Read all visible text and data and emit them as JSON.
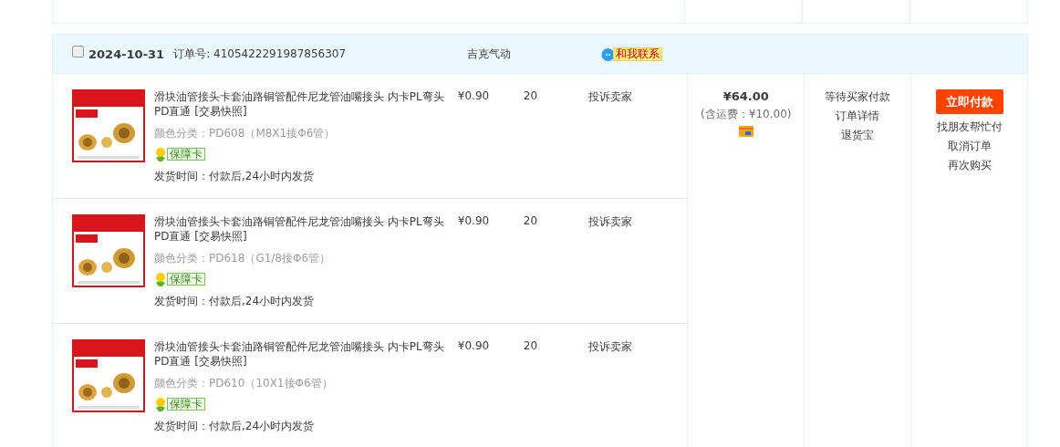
{
  "order": {
    "selected": false,
    "date": "2024-10-31",
    "order_no_label": "订单号:",
    "order_no": "4105422291987856307",
    "shop": "吉克气动",
    "contact": "和我联系",
    "items": [
      {
        "title": "滑块油管接头卡套油路铜管配件尼龙管油嘴接头 内卡PL弯头 PD直通",
        "snapshot": "[交易快照]",
        "variant": "颜色分类：PD608（M8X1接Φ6管）",
        "guarantee": "保障卡",
        "ship": "发货时间：付款后,24小时内发货",
        "price": "¥0.90",
        "qty": "20",
        "service": "投诉卖家"
      },
      {
        "title": "滑块油管接头卡套油路铜管配件尼龙管油嘴接头 内卡PL弯头 PD直通",
        "snapshot": "[交易快照]",
        "variant": "颜色分类：PD618（G1/8接Φ6管）",
        "guarantee": "保障卡",
        "ship": "发货时间：付款后,24小时内发货",
        "price": "¥0.90",
        "qty": "20",
        "service": "投诉卖家"
      },
      {
        "title": "滑块油管接头卡套油路铜管配件尼龙管油嘴接头 内卡PL弯头 PD直通",
        "snapshot": "[交易快照]",
        "variant": "颜色分类：PD610（10X1接Φ6管）",
        "guarantee": "保障卡",
        "ship": "发货时间：付款后,24小时内发货",
        "price": "¥0.90",
        "qty": "20",
        "service": "投诉卖家"
      }
    ],
    "total": "¥64.00",
    "shipping": "(含运费：¥10.00)",
    "status": [
      "等待买家付款",
      "订单详情",
      "退货宝"
    ],
    "pay_button": "立即付款",
    "actions": [
      "找朋友帮忙付",
      "取消订单",
      "再次购买"
    ]
  }
}
